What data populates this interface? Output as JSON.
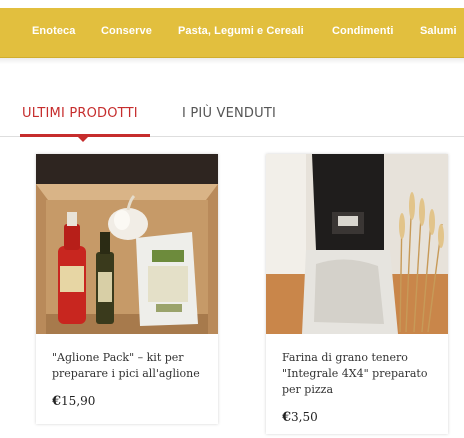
{
  "nav": {
    "categories": [
      "Enoteca",
      "Conserve",
      "Pasta, Legumi e Cereali",
      "Condimenti",
      "Salumi"
    ]
  },
  "tabs": [
    {
      "label": "ULTIMI PRODOTTI",
      "active": true
    },
    {
      "label": "I PIÙ VENDUTI",
      "active": false
    }
  ],
  "products": [
    {
      "title": "\"Aglione Pack\" – kit per preparare i pici all'aglione",
      "currency": "€",
      "price": "15,90"
    },
    {
      "title": "Farina di grano tenero \"Integrale 4X4\" preparato per pizza",
      "currency": "€",
      "price": "3,50"
    }
  ],
  "colors": {
    "topbar": "#e2bf3e",
    "accent": "#c62d2d"
  }
}
